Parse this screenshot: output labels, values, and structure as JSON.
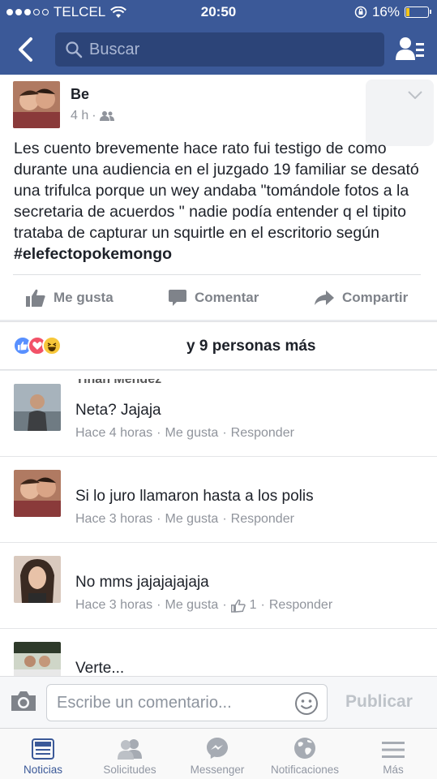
{
  "status_bar": {
    "carrier": "TELCEL",
    "time": "20:50",
    "battery": "16%",
    "battery_level": 0.16
  },
  "nav": {
    "search_placeholder": "Buscar"
  },
  "post": {
    "author": "Be",
    "time": "4 h",
    "privacy_icon": "friends-icon",
    "text": "Les cuento brevemente hace rato fui testigo de como durante una audiencia en el juzgado 19 familiar se desató una trifulca porque un wey andaba \"tomándole fotos a la secretaria de acuerdos \" nadie podía entender q el tipito trataba de capturar un squirtle en el escritorio según ",
    "hashtag": "#elefectopokemongo",
    "actions": {
      "like": "Me gusta",
      "comment": "Comentar",
      "share": "Compartir"
    }
  },
  "reactions": {
    "text": "y 9 personas más",
    "icons": [
      "like",
      "love",
      "haha"
    ]
  },
  "comments": [
    {
      "author": "Yihan Mendez",
      "text": "Neta? Jajaja",
      "time": "Hace 4 horas",
      "like": "Me gusta",
      "reply": "Responder",
      "likes_count": ""
    },
    {
      "author": "",
      "text": "Si lo juro llamaron hasta a los polis",
      "time": "Hace 3 horas",
      "like": "Me gusta",
      "reply": "Responder",
      "likes_count": ""
    },
    {
      "author": "",
      "text": "No mms jajajajajaja",
      "time": "Hace 3 horas",
      "like": "Me gusta",
      "reply": "Responder",
      "likes_count": "1"
    },
    {
      "author": "",
      "text": "Verte...",
      "time": "",
      "like": "",
      "reply": "",
      "likes_count": ""
    }
  ],
  "composer": {
    "placeholder": "Escribe un comentario...",
    "publish": "Publicar"
  },
  "tabs": [
    {
      "label": "Noticias",
      "icon": "news-feed-icon",
      "active": true
    },
    {
      "label": "Solicitudes",
      "icon": "friend-requests-icon",
      "active": false
    },
    {
      "label": "Messenger",
      "icon": "messenger-icon",
      "active": false
    },
    {
      "label": "Notificaciones",
      "icon": "globe-icon",
      "active": false
    },
    {
      "label": "Más",
      "icon": "menu-icon",
      "active": false
    }
  ],
  "colors": {
    "brand": "#3b5998",
    "muted": "#90949c",
    "search_bg": "#2c4478"
  }
}
